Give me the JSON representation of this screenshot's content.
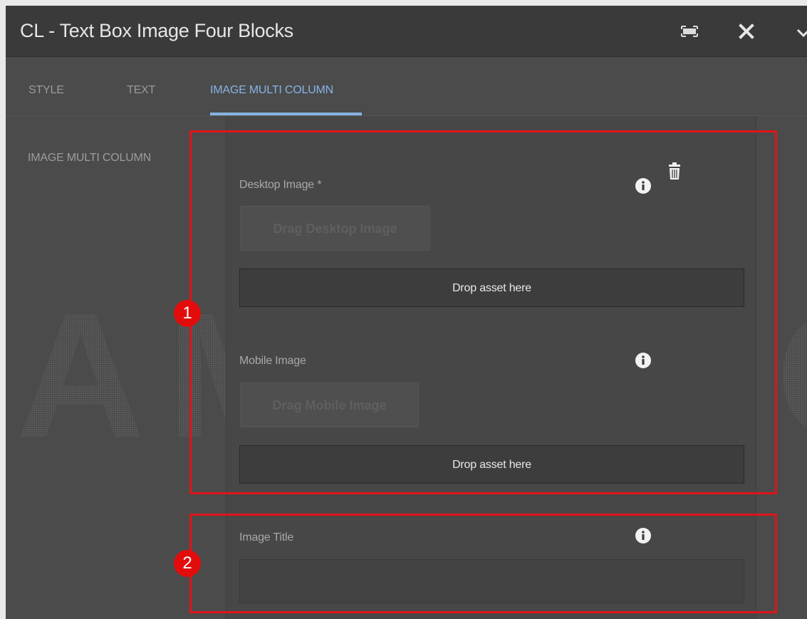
{
  "dialog": {
    "title": "CL - Text Box Image Four Blocks",
    "icons": {
      "fullscreen": "fullscreen-icon",
      "close": "close-icon",
      "collapse": "chevron-down-icon"
    }
  },
  "tabs": [
    {
      "label": "STYLE",
      "active": false
    },
    {
      "label": "TEXT",
      "active": false
    },
    {
      "label": "IMAGE MULTI COLUMN",
      "active": true
    }
  ],
  "section_label": "IMAGE MULTI COLUMN",
  "fields": {
    "desktop_image": {
      "label": "Desktop Image *",
      "drag_text": "Drag Desktop Image",
      "drop_text": "Drop asset here"
    },
    "mobile_image": {
      "label": "Mobile Image",
      "drag_text": "Drag Mobile Image",
      "drop_text": "Drop asset here"
    },
    "image_title": {
      "label": "Image Title",
      "value": ""
    }
  },
  "watermark": "SAMSUNG",
  "callouts": [
    {
      "number": "1"
    },
    {
      "number": "2"
    }
  ],
  "colors": {
    "accent_tab": "#87b3e6",
    "callout": "#e0141a"
  }
}
